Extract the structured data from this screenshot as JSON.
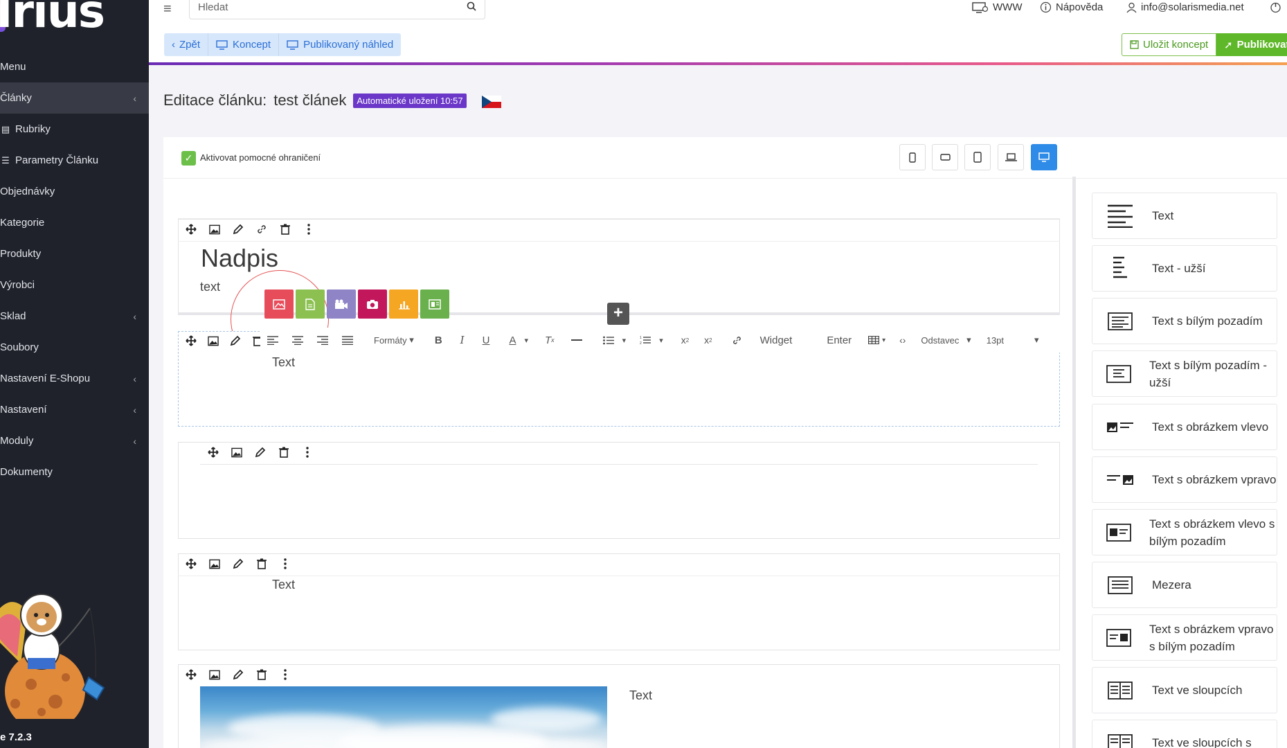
{
  "sidebar": {
    "logo": "Irius",
    "items": [
      {
        "label": "Menu"
      },
      {
        "label": "Články"
      },
      {
        "label": "Rubriky"
      },
      {
        "label": "Parametry Článku"
      },
      {
        "label": "Objednávky"
      },
      {
        "label": "Kategorie"
      },
      {
        "label": "Produkty"
      },
      {
        "label": "Výrobci"
      },
      {
        "label": "Sklad"
      },
      {
        "label": "Soubory"
      },
      {
        "label": "Nastavení E-Shopu"
      },
      {
        "label": "Nastavení"
      },
      {
        "label": "Moduly"
      },
      {
        "label": "Dokumenty"
      }
    ],
    "version": "e 7.2.3"
  },
  "topbar": {
    "search_placeholder": "Hledat",
    "www": "WWW",
    "help": "Nápověda",
    "email": "info@solarismedia.net"
  },
  "actions": {
    "back": "Zpět",
    "draft": "Koncept",
    "preview": "Publikovaný náhled",
    "save_draft": "Uložit koncept",
    "publish": "Publikovat"
  },
  "page": {
    "title_prefix": "Editace článku:",
    "title_name": "test článek",
    "autosave": "Automatické uložení 10:57"
  },
  "editor": {
    "helper_label": "Aktivovat pomocné ohraničení",
    "heading": "Nadpis",
    "body_text": "text",
    "block_text": "Text",
    "toolbar": {
      "formats": "Formáty",
      "widget": "Widget",
      "enter": "Enter",
      "paragraph": "Odstavec",
      "font_size": "13pt"
    },
    "insert_colors": [
      "#e74c5b",
      "#8cc152",
      "#8e84c6",
      "#c2185b",
      "#f5a623",
      "#6ab04c"
    ]
  },
  "palette": [
    {
      "label": "Text",
      "icon": "text-align-icon"
    },
    {
      "label": "Text - užší",
      "icon": "text-narrow-icon"
    },
    {
      "label": "Text s bílým pozadím",
      "icon": "text-box-icon"
    },
    {
      "label": "Text s bílým pozadím - užší",
      "icon": "text-box-narrow-icon"
    },
    {
      "label": "Text s obrázkem vlevo",
      "icon": "image-left-icon"
    },
    {
      "label": "Text s obrázkem vpravo",
      "icon": "image-right-icon"
    },
    {
      "label": "Text s obrázkem vlevo s bílým pozadím",
      "icon": "image-left-box-icon"
    },
    {
      "label": "Mezera",
      "icon": "spacer-icon"
    },
    {
      "label": "Text s obrázkem vpravo s bílým pozadím",
      "icon": "image-right-box-icon"
    },
    {
      "label": "Text ve sloupcích",
      "icon": "columns-icon"
    },
    {
      "label": "Text ve sloupcích s",
      "icon": "columns-box-icon"
    }
  ]
}
